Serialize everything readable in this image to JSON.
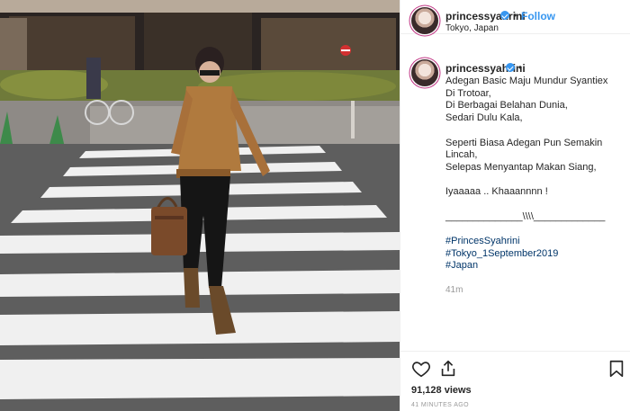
{
  "header": {
    "username": "princessyahrini",
    "separator": "•",
    "follow_label": "Follow",
    "location": "Tokyo, Japan",
    "more_icon": "more-horizontal-icon"
  },
  "caption": {
    "username": "princessyahrini",
    "separator": "•",
    "paragraph1": [
      "Adegan Basic Maju Mundur Syantiex",
      "Di Trotoar,",
      "Di Berbagai Belahan Dunia,",
      "Sedari Dulu Kala,"
    ],
    "paragraph2": [
      "Seperti Biasa Adegan Pun Semakin",
      "Lincah,",
      "Selepas Menyantap Makan Siang,"
    ],
    "paragraph3": [
      "Iyaaaaa .. Khaaannnn !"
    ],
    "divider": "______________\\\\\\\\_____________",
    "hashtags": [
      "#PrincesSyahrini",
      "#Tokyo_1September2019",
      "#Japan"
    ],
    "time_ago": "41m"
  },
  "actions": {
    "icons": [
      "heart-icon",
      "share-icon",
      "bookmark-icon"
    ],
    "views": "91,128 views",
    "posted": "41 MINUTES AGO"
  },
  "colors": {
    "accent": "#3897f0",
    "hashtag": "#003569",
    "muted": "#999999",
    "text": "#262626",
    "avatar_ring": "#c13584"
  }
}
